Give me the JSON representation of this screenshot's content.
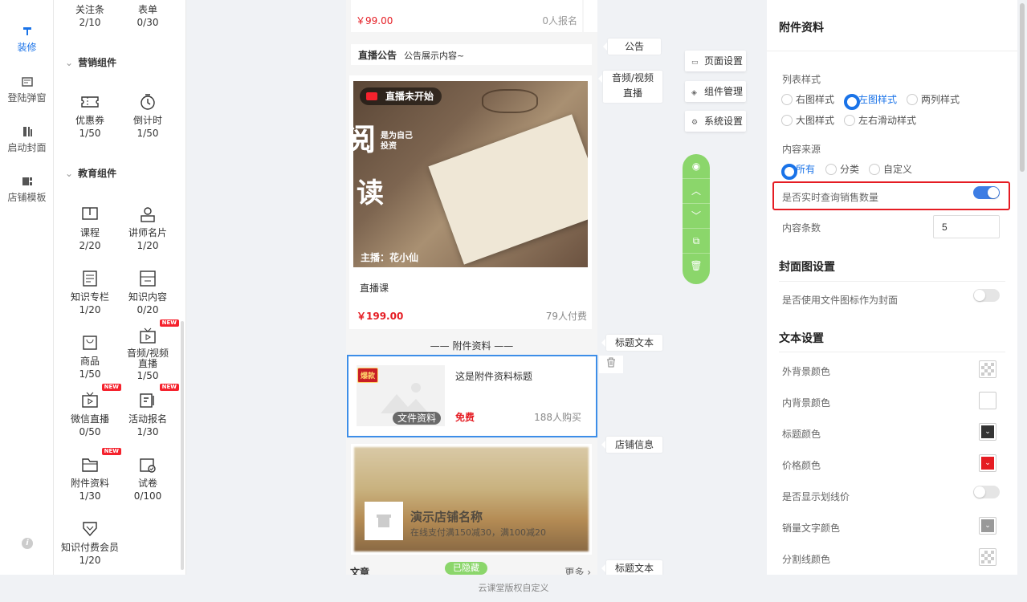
{
  "left_nav": {
    "items": [
      {
        "label": "装修",
        "icon": "brush-icon"
      },
      {
        "label": "登陆弹窗",
        "icon": "popup-icon"
      },
      {
        "label": "启动封面",
        "icon": "cover-icon"
      },
      {
        "label": "店铺模板",
        "icon": "template-icon"
      }
    ],
    "active_color": "#1a73e8"
  },
  "components": {
    "top_items": [
      {
        "label": "关注条",
        "count": "2/10"
      },
      {
        "label": "表单",
        "count": "0/30"
      }
    ],
    "marketing_title": "营销组件",
    "marketing_items": [
      {
        "label": "优惠券",
        "count": "1/50",
        "icon": "coupon-icon"
      },
      {
        "label": "倒计时",
        "count": "1/50",
        "icon": "timer-icon"
      }
    ],
    "education_title": "教育组件",
    "education_items": [
      {
        "label": "课程",
        "count": "2/20",
        "icon": "course-icon"
      },
      {
        "label": "讲师名片",
        "count": "1/20",
        "icon": "teacher-card-icon"
      },
      {
        "label": "知识专栏",
        "count": "1/20",
        "icon": "column-icon"
      },
      {
        "label": "知识内容",
        "count": "0/20",
        "icon": "content-icon"
      },
      {
        "label": "商品",
        "count": "1/50",
        "icon": "product-icon"
      },
      {
        "label": "音频/视频直播",
        "count": "1/50",
        "icon": "av-live-icon",
        "badge": "NEW"
      },
      {
        "label": "微信直播",
        "count": "0/50",
        "icon": "wechat-live-icon",
        "badge": "NEW"
      },
      {
        "label": "活动报名",
        "count": "1/30",
        "icon": "signup-icon",
        "badge": "NEW"
      },
      {
        "label": "附件资料",
        "count": "1/30",
        "icon": "folder-icon",
        "badge": "NEW"
      },
      {
        "label": "试卷",
        "count": "0/100",
        "icon": "exam-icon"
      },
      {
        "label": "知识付费会员",
        "count": "1/20",
        "icon": "vip-icon"
      }
    ]
  },
  "phone": {
    "top_card": {
      "price": "￥99.00",
      "signup": "0人报名"
    },
    "notice": {
      "title": "直播公告",
      "text": "公告展示内容~"
    },
    "live": {
      "status": "直播未开始",
      "overlay_big1": "阅",
      "overlay_small": "是为自己投资",
      "overlay_big2": "读",
      "host": "主播：花小仙",
      "title": "直播课",
      "price": "￥199.00",
      "paid": "79人付费"
    },
    "attach_header": "—— 附件资料 ——",
    "attach": {
      "tag": "爆款",
      "file_label": "文件资料",
      "title": "这是附件资料标题",
      "price": "免费",
      "buyers": "188人购买"
    },
    "store": {
      "name": "演示店铺名称",
      "promo": "在线支付满150减30，满100减20"
    },
    "article": {
      "label": "文章",
      "badge": "已隐藏",
      "more": "更多"
    }
  },
  "canvas_labels": {
    "notice": "公告",
    "av_live": "音频/视频直播",
    "title_text_1": "标题文本",
    "store_info": "店铺信息",
    "title_text_2": "标题文本"
  },
  "side_buttons": {
    "page_settings": "页面设置",
    "component_mgmt": "组件管理",
    "system_settings": "系统设置"
  },
  "panel": {
    "title": "附件资料",
    "list_style_label": "列表样式",
    "list_styles": [
      {
        "label": "右图样式",
        "checked": false
      },
      {
        "label": "左图样式",
        "checked": true
      },
      {
        "label": "两列样式",
        "checked": false
      },
      {
        "label": "大图样式",
        "checked": false
      },
      {
        "label": "左右滑动样式",
        "checked": false
      }
    ],
    "source_label": "内容来源",
    "sources": [
      {
        "label": "所有",
        "checked": true
      },
      {
        "label": "分类",
        "checked": false
      },
      {
        "label": "自定义",
        "checked": false
      }
    ],
    "realtime_label": "是否实时查询销售数量",
    "realtime_on": true,
    "count_label": "内容条数",
    "count_value": "5",
    "cover_section": "封面图设置",
    "use_file_icon_label": "是否使用文件图标作为封面",
    "use_file_icon_on": false,
    "text_section": "文本设置",
    "colors": [
      {
        "label": "外背景颜色",
        "color": "checker"
      },
      {
        "label": "内背景颜色",
        "color": "#ffffff"
      },
      {
        "label": "标题颜色",
        "color": "#333333"
      },
      {
        "label": "价格颜色",
        "color": "#e51c23"
      }
    ],
    "strike_label": "是否显示划线价",
    "strike_on": false,
    "colors2": [
      {
        "label": "销量文字颜色",
        "color": "#999999"
      },
      {
        "label": "分割线颜色",
        "color": "checker"
      }
    ]
  },
  "footer": "云课堂版权自定义"
}
